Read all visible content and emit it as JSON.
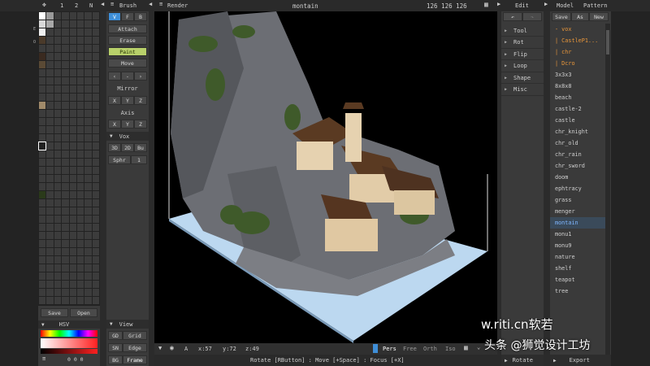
{
  "top_left_tabs": [
    "1",
    "2",
    "N"
  ],
  "brush": {
    "header": "Brush",
    "modes": [
      "V",
      "F",
      "B"
    ],
    "buttons": [
      "Attach",
      "Erase",
      "Paint",
      "Move"
    ],
    "arrows": [
      "‹",
      "-",
      "›"
    ]
  },
  "mirror": {
    "label": "Mirror",
    "axes": [
      "X",
      "Y",
      "Z"
    ]
  },
  "axis": {
    "label": "Axis",
    "axes": [
      "X",
      "Y",
      "Z"
    ]
  },
  "vox": {
    "header": "Vox",
    "modes": [
      "3D",
      "2D",
      "Bu"
    ],
    "sphr_label": "Sphr",
    "sphr_value": "1"
  },
  "view": {
    "header": "View",
    "rows": [
      [
        "GD",
        "Grid"
      ],
      [
        "SN",
        "Edge"
      ],
      [
        "BG",
        "Frame"
      ]
    ]
  },
  "palette": {
    "save": "Save",
    "open": "Open",
    "hsv": "HSV",
    "rgb": "0 0 0"
  },
  "render_tab": "Render",
  "title": "montain",
  "dims": "126 126 126",
  "edit": {
    "header": "Edit",
    "items": [
      "Tool",
      "Rot",
      "Flip",
      "Loop",
      "Shape",
      "Misc"
    ]
  },
  "model": {
    "tabs": [
      "Model",
      "Pattern"
    ],
    "actions": [
      "Save",
      "As",
      "New"
    ],
    "items": [
      "- vox",
      "| CastleP1...",
      "| chr",
      "| Dcro",
      "3x3x3",
      "8x8x8",
      "beach",
      "castle-2",
      "castle",
      "chr_knight",
      "chr_old",
      "chr_rain",
      "chr_sword",
      "doom",
      "ephtracy",
      "grass",
      "menger",
      "montain",
      "monu1",
      "monu9",
      "nature",
      "shelf",
      "teapot",
      "tree"
    ],
    "selected": "montain"
  },
  "bottom": {
    "camera_label": "A",
    "x": "x:57",
    "y": "y:72",
    "z": "z:49",
    "modes": [
      "Pers",
      "Free",
      "Orth",
      "Iso"
    ],
    "hint": "Rotate [RButton] : Move [+Space] : Focus [+X]",
    "rotate": "Rotate",
    "export": "Export"
  },
  "watermark": "头条 @狮觉设计工坊",
  "watermark2": "w.riti.cn软若",
  "colors": {
    "accent": "#3f8fd8",
    "paint": "#b8d06a",
    "selected_text": "#7fb6ff"
  }
}
